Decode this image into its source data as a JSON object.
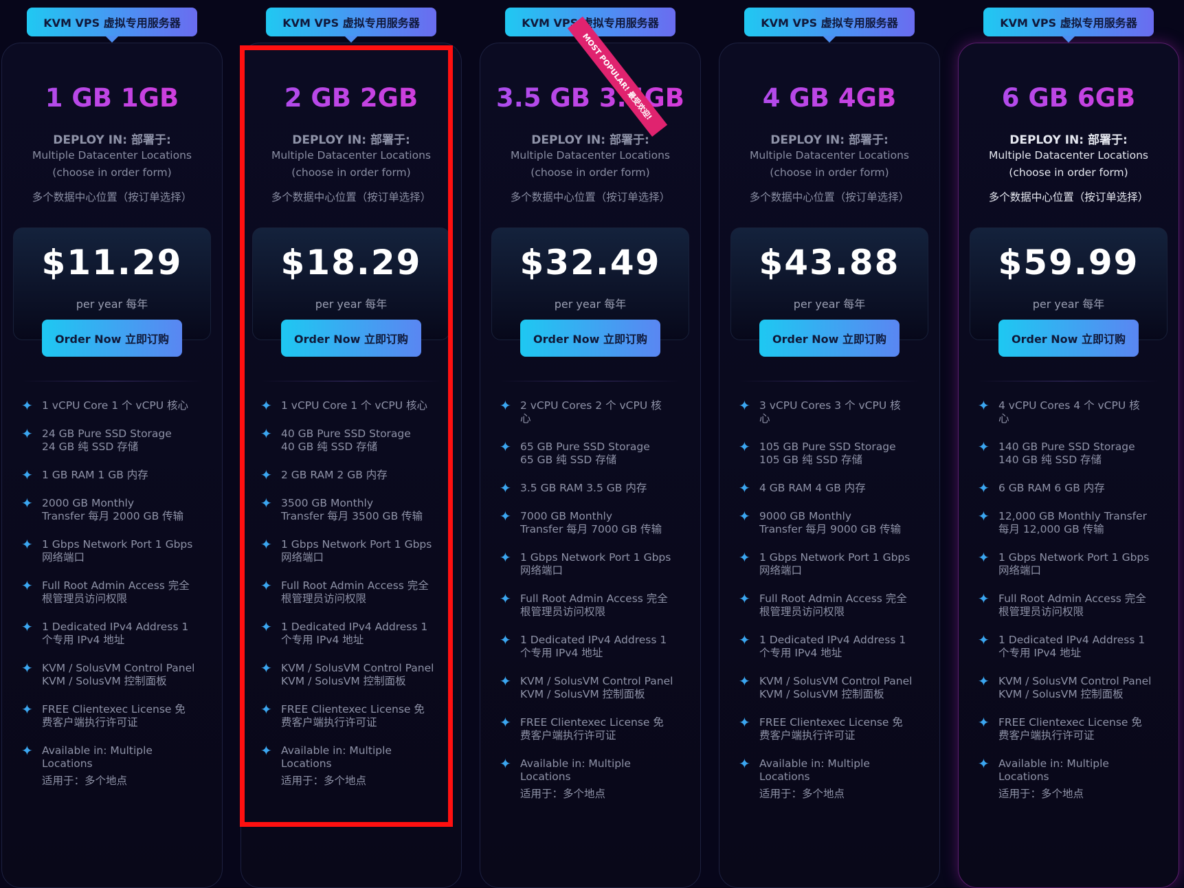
{
  "plans": [
    {
      "tag": "KVM VPS 虚拟专用服务器",
      "title": "1 GB  1GB",
      "deploy": "DEPLOY IN: 部署于:",
      "loc1": "Multiple Datacenter Locations",
      "loc2": "(choose in order form)",
      "loc3": "多个数据中心位置（按订单选择）",
      "price": "$11.29",
      "per": "per year  每年",
      "order": "Order Now  立即订购",
      "features": [
        [
          "1 vCPU Core  1 个 vCPU 核心"
        ],
        [
          "24 GB Pure SSD Storage",
          "24 GB 纯 SSD 存储"
        ],
        [
          "1 GB RAM  1 GB 内存"
        ],
        [
          "2000 GB Monthly",
          "Transfer  每月 2000 GB 传输"
        ],
        [
          "1 Gbps Network Port  1 Gbps",
          "网络端口"
        ],
        [
          "Full Root Admin Access  完全",
          "根管理员访问权限"
        ],
        [
          "1 Dedicated IPv4 Address  1",
          "个专用 IPv4 地址"
        ],
        [
          "KVM / SolusVM Control Panel",
          "KVM / SolusVM 控制面板"
        ],
        [
          "FREE Clientexec License  免",
          "费客户端执行许可证"
        ],
        [
          "Available in: Multiple",
          "Locations",
          "适用于：多个地点"
        ]
      ]
    },
    {
      "tag": "KVM VPS 虚拟专用服务器",
      "title": "2 GB  2GB",
      "deploy": "DEPLOY IN: 部署于:",
      "loc1": "Multiple Datacenter Locations",
      "loc2": "(choose in order form)",
      "loc3": "多个数据中心位置（按订单选择）",
      "price": "$18.29",
      "per": "per year  每年",
      "order": "Order Now  立即订购",
      "features": [
        [
          "1 vCPU Core  1 个 vCPU 核心"
        ],
        [
          "40 GB Pure SSD Storage",
          "40 GB 纯 SSD 存储"
        ],
        [
          "2 GB RAM  2 GB 内存"
        ],
        [
          "3500 GB Monthly",
          "Transfer  每月 3500 GB 传输"
        ],
        [
          "1 Gbps Network Port  1 Gbps",
          "网络端口"
        ],
        [
          "Full Root Admin Access  完全",
          "根管理员访问权限"
        ],
        [
          "1 Dedicated IPv4 Address  1",
          "个专用 IPv4 地址"
        ],
        [
          "KVM / SolusVM Control Panel",
          "KVM / SolusVM 控制面板"
        ],
        [
          "FREE Clientexec License  免",
          "费客户端执行许可证"
        ],
        [
          "Available in: Multiple",
          "Locations",
          "适用于：多个地点"
        ]
      ]
    },
    {
      "tag": "KVM VPS 虚拟专用服务器",
      "title": "3.5 GB  3.5GB",
      "deploy": "DEPLOY IN: 部署于:",
      "loc1": "Multiple Datacenter Locations",
      "loc2": "(choose in order form)",
      "loc3": "多个数据中心位置（按订单选择）",
      "price": "$32.49",
      "per": "per year  每年",
      "order": "Order Now  立即订购",
      "features": [
        [
          "2 vCPU Cores  2 个 vCPU 核",
          "心"
        ],
        [
          "65 GB Pure SSD Storage",
          "65 GB 纯 SSD 存储"
        ],
        [
          "3.5 GB RAM  3.5 GB 内存"
        ],
        [
          "7000 GB Monthly",
          "Transfer  每月 7000 GB 传输"
        ],
        [
          "1 Gbps Network Port  1 Gbps",
          "网络端口"
        ],
        [
          "Full Root Admin Access  完全",
          "根管理员访问权限"
        ],
        [
          "1 Dedicated IPv4 Address  1",
          "个专用 IPv4 地址"
        ],
        [
          "KVM / SolusVM Control Panel",
          "KVM / SolusVM 控制面板"
        ],
        [
          "FREE Clientexec License  免",
          "费客户端执行许可证"
        ],
        [
          "Available in: Multiple",
          "Locations",
          "适用于：多个地点"
        ]
      ]
    },
    {
      "tag": "KVM VPS 虚拟专用服务器",
      "title": "4 GB  4GB",
      "deploy": "DEPLOY IN: 部署于:",
      "loc1": "Multiple Datacenter Locations",
      "loc2": "(choose in order form)",
      "loc3": "多个数据中心位置（按订单选择）",
      "price": "$43.88",
      "per": "per year  每年",
      "order": "Order Now  立即订购",
      "features": [
        [
          "3 vCPU Cores  3 个 vCPU 核",
          "心"
        ],
        [
          "105 GB Pure SSD Storage",
          "105 GB 纯 SSD 存储"
        ],
        [
          "4 GB RAM  4 GB 内存"
        ],
        [
          "9000 GB Monthly",
          "Transfer  每月 9000 GB 传输"
        ],
        [
          "1 Gbps Network Port  1 Gbps",
          "网络端口"
        ],
        [
          "Full Root Admin Access  完全",
          "根管理员访问权限"
        ],
        [
          "1 Dedicated IPv4 Address  1",
          "个专用 IPv4 地址"
        ],
        [
          "KVM / SolusVM Control Panel",
          "KVM / SolusVM 控制面板"
        ],
        [
          "FREE Clientexec License  免",
          "费客户端执行许可证"
        ],
        [
          "Available in: Multiple",
          "Locations",
          "适用于：多个地点"
        ]
      ]
    },
    {
      "tag": "KVM VPS 虚拟专用服务器",
      "title": "6 GB  6GB",
      "deploy": "DEPLOY IN: 部署于:",
      "loc1": "Multiple Datacenter Locations",
      "loc2": "(choose in order form)",
      "loc3": "多个数据中心位置（按订单选择）",
      "price": "$59.99",
      "per": "per year  每年",
      "order": "Order Now  立即订购",
      "features": [
        [
          "4 vCPU Cores  4 个 vCPU 核",
          "心"
        ],
        [
          "140 GB Pure SSD Storage",
          "140 GB 纯 SSD 存储"
        ],
        [
          "6 GB RAM  6 GB 内存"
        ],
        [
          "12,000 GB Monthly Transfer",
          "每月 12,000 GB 传输"
        ],
        [
          "1 Gbps Network Port  1 Gbps",
          "网络端口"
        ],
        [
          "Full Root Admin Access  完全",
          "根管理员访问权限"
        ],
        [
          "1 Dedicated IPv4 Address  1",
          "个专用 IPv4 地址"
        ],
        [
          "KVM / SolusVM Control Panel",
          "KVM / SolusVM 控制面板"
        ],
        [
          "FREE Clientexec License  免",
          "费客户端执行许可证"
        ],
        [
          "Available in: Multiple",
          "Locations",
          "适用于：多个地点"
        ]
      ]
    }
  ],
  "badge": "MOST POPULAR!  最受欢迎!",
  "colors": {
    "accent": "#20c8f2",
    "title": "#c23be0",
    "badge": "#e0236f",
    "highlight": "#ff1010"
  }
}
